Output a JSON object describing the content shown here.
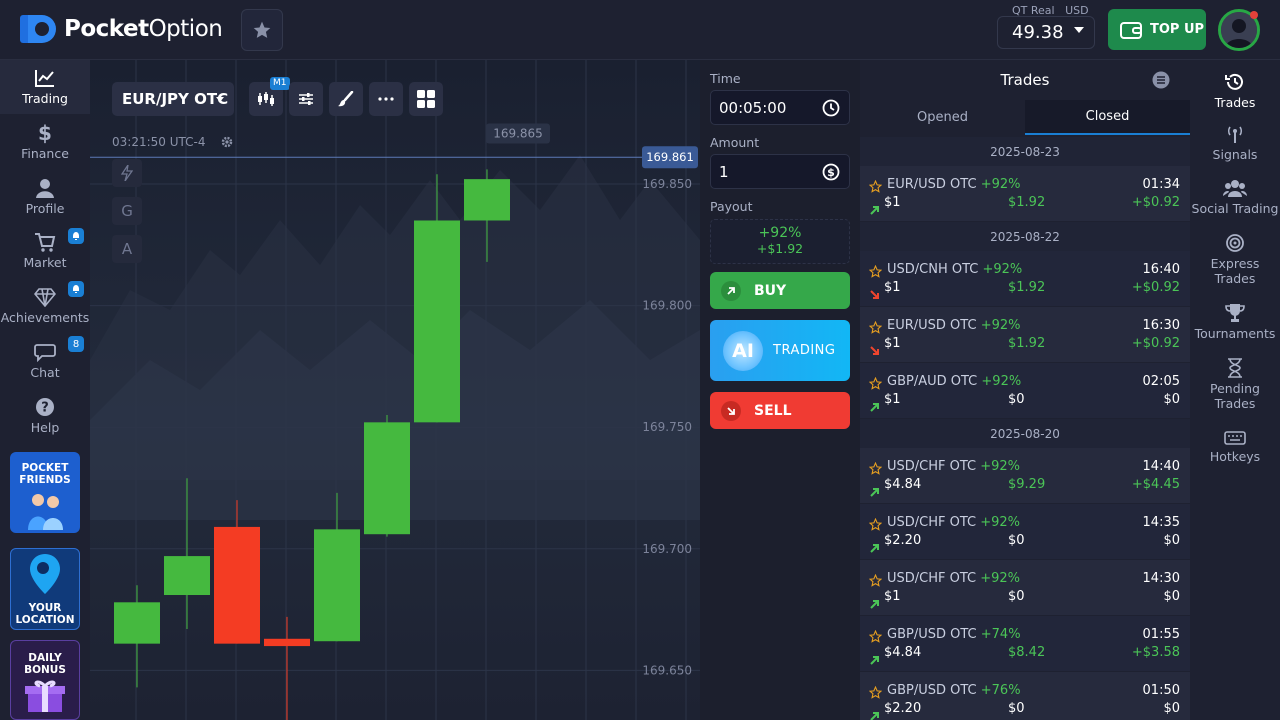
{
  "header": {
    "logo_bold": "Pocket",
    "logo_thin": "Option",
    "account_type": "QT Real",
    "currency": "USD",
    "balance": "49.38",
    "topup_label": "TOP UP"
  },
  "left_nav": {
    "items": [
      {
        "label": "Trading",
        "icon": "chart-line-icon"
      },
      {
        "label": "Finance",
        "icon": "dollar-icon"
      },
      {
        "label": "Profile",
        "icon": "user-icon"
      },
      {
        "label": "Market",
        "icon": "cart-icon"
      },
      {
        "label": "Achievements",
        "icon": "diamond-icon"
      },
      {
        "label": "Chat",
        "icon": "chat-icon",
        "badge": "8"
      },
      {
        "label": "Help",
        "icon": "help-icon"
      }
    ],
    "promos": [
      {
        "label": "POCKET FRIENDS"
      },
      {
        "label": "YOUR LOCATION"
      },
      {
        "label": "DAILY BONUS"
      }
    ]
  },
  "chart": {
    "pair": "EUR/JPY OTC",
    "timeframe_badge": "M1",
    "clock": "03:21:50 UTC-4",
    "side_tools": [
      "G",
      "A"
    ],
    "price_ticks": [
      {
        "label": "169.850",
        "value": 169.85
      },
      {
        "label": "169.800",
        "value": 169.8
      },
      {
        "label": "169.750",
        "value": 169.75
      },
      {
        "label": "169.700",
        "value": 169.7
      },
      {
        "label": "169.650",
        "value": 169.65
      }
    ],
    "current_price": "169.861",
    "current_price_value": 169.861,
    "high_marker": "169.865",
    "high_marker_value": 169.865,
    "candles": [
      {
        "o": 169.661,
        "c": 169.678,
        "h": 169.685,
        "l": 169.643
      },
      {
        "o": 169.681,
        "c": 169.697,
        "h": 169.729,
        "l": 169.667
      },
      {
        "o": 169.709,
        "c": 169.661,
        "h": 169.72,
        "l": 169.661
      },
      {
        "o": 169.663,
        "c": 169.66,
        "h": 169.672,
        "l": 169.617
      },
      {
        "o": 169.662,
        "c": 169.708,
        "h": 169.723,
        "l": 169.662
      },
      {
        "o": 169.706,
        "c": 169.752,
        "h": 169.755,
        "l": 169.705
      },
      {
        "o": 169.752,
        "c": 169.835,
        "h": 169.854,
        "l": 169.752
      },
      {
        "o": 169.835,
        "c": 169.852,
        "h": 169.856,
        "l": 169.818
      }
    ]
  },
  "trade_panel": {
    "time_label": "Time",
    "time_value": "00:05:00",
    "amount_label": "Amount",
    "amount_value": "1",
    "payout_label": "Payout",
    "payout_pct": "+92%",
    "payout_amount": "+$1.92",
    "buy_label": "BUY",
    "ai_badge": "AI",
    "ai_label": "TRADING",
    "sell_label": "SELL"
  },
  "trades": {
    "title": "Trades",
    "tabs": [
      "Opened",
      "Closed"
    ],
    "groups": [
      {
        "date": "2025-08-23",
        "rows": [
          {
            "pair": "EUR/USD OTC",
            "pct": "+92%",
            "time": "01:34",
            "dir": "up",
            "amount": "$1",
            "payout": "$1.92",
            "profit": "+$0.92"
          }
        ]
      },
      {
        "date": "2025-08-22",
        "rows": [
          {
            "pair": "USD/CNH OTC",
            "pct": "+92%",
            "time": "16:40",
            "dir": "down",
            "amount": "$1",
            "payout": "$1.92",
            "profit": "+$0.92"
          },
          {
            "pair": "EUR/USD OTC",
            "pct": "+92%",
            "time": "16:30",
            "dir": "down",
            "amount": "$1",
            "payout": "$1.92",
            "profit": "+$0.92"
          },
          {
            "pair": "GBP/AUD OTC",
            "pct": "+92%",
            "time": "02:05",
            "dir": "up",
            "amount": "$1",
            "payout": "$0",
            "profit": "$0"
          }
        ]
      },
      {
        "date": "2025-08-20",
        "rows": [
          {
            "pair": "USD/CHF OTC",
            "pct": "+92%",
            "time": "14:40",
            "dir": "up",
            "amount": "$4.84",
            "payout": "$9.29",
            "profit": "+$4.45"
          },
          {
            "pair": "USD/CHF OTC",
            "pct": "+92%",
            "time": "14:35",
            "dir": "up",
            "amount": "$2.20",
            "payout": "$0",
            "profit": "$0"
          },
          {
            "pair": "USD/CHF OTC",
            "pct": "+92%",
            "time": "14:30",
            "dir": "up",
            "amount": "$1",
            "payout": "$0",
            "profit": "$0"
          },
          {
            "pair": "GBP/USD OTC",
            "pct": "+74%",
            "time": "01:55",
            "dir": "up",
            "amount": "$4.84",
            "payout": "$8.42",
            "profit": "+$3.58"
          },
          {
            "pair": "GBP/USD OTC",
            "pct": "+76%",
            "time": "01:50",
            "dir": "up",
            "amount": "$2.20",
            "payout": "$0",
            "profit": "$0"
          }
        ]
      }
    ]
  },
  "right_nav": {
    "items": [
      {
        "label": "Trades",
        "icon": "history-icon"
      },
      {
        "label": "Signals",
        "icon": "signal-icon"
      },
      {
        "label": "Social Trading",
        "icon": "users-icon"
      },
      {
        "label": "Express Trades",
        "icon": "target-icon"
      },
      {
        "label": "Tournaments",
        "icon": "trophy-icon"
      },
      {
        "label": "Pending Trades",
        "icon": "hourglass-icon"
      },
      {
        "label": "Hotkeys",
        "icon": "keyboard-icon"
      }
    ]
  },
  "colors": {
    "up": "#45b93f",
    "down": "#f43c23",
    "accent": "#1a7fd4",
    "buy": "#35a84a",
    "sell": "#f03b33"
  }
}
